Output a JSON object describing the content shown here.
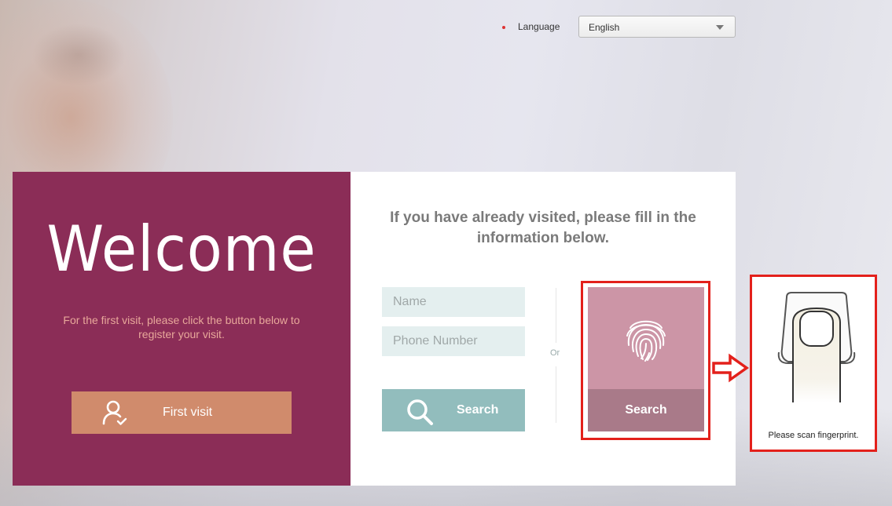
{
  "header": {
    "language_label": "Language",
    "language_value": "English"
  },
  "welcome_panel": {
    "title": "Welcome",
    "description": "For the first visit, please click the button below to register your visit.",
    "first_visit_button": "First visit"
  },
  "lookup_panel": {
    "title": "If you have already visited, please fill in the information below.",
    "name_placeholder": "Name",
    "phone_placeholder": "Phone Number",
    "search_button": "Search",
    "or_label": "Or",
    "fingerprint_search_button": "Search"
  },
  "scan_panel": {
    "instruction": "Please scan fingerprint."
  },
  "colors": {
    "welcome_bg": "#8b2d57",
    "first_visit_btn": "#d08b6c",
    "search_btn": "#92bdbd",
    "fingerprint_top": "#cc95a6",
    "fingerprint_bottom": "#a97a89",
    "highlight": "#e3201b"
  }
}
